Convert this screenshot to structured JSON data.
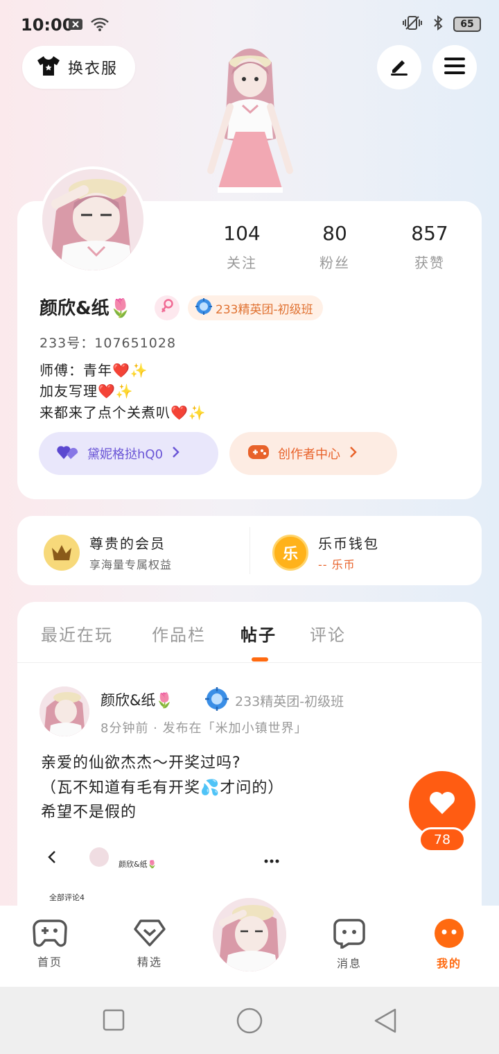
{
  "status_bar": {
    "time": "10:00",
    "battery": "65"
  },
  "top": {
    "outfit_label": "换衣服"
  },
  "profile": {
    "stats": [
      {
        "value": "104",
        "label": "关注"
      },
      {
        "value": "80",
        "label": "粉丝"
      },
      {
        "value": "857",
        "label": "获赞"
      }
    ],
    "username": "颜欣&纸🌷",
    "rank_badge": "233精英团-初级班",
    "uid": "233号：107651028",
    "bio": [
      "师傅：青年❤️✨",
      "加友写理❤️✨",
      "来都来了点个关煮叭❤️✨"
    ],
    "guild_label": "黛妮格挞hQ0",
    "creator_label": "创作者中心"
  },
  "member": {
    "vip_title": "尊贵的会员",
    "vip_sub": "享海量专属权益",
    "wallet_title": "乐币钱包",
    "wallet_sub": "-- 乐币",
    "coin_glyph": "乐"
  },
  "tabs": [
    "最近在玩",
    "作品栏",
    "帖子",
    "评论"
  ],
  "post": {
    "author": "颜欣&纸🌷",
    "rank": "233精英团-初级班",
    "meta": "8分钟前 · 发布在「米加小镇世界」",
    "lines": [
      "亲爱的仙欲杰杰～开奖过吗?",
      "（瓦不知道有毛有开奖💦才问的）",
      "希望不是假的"
    ],
    "image_author": "颜欣&纸🌷",
    "image_comments": "全部评论4"
  },
  "like_count": "78",
  "bottom_nav": [
    {
      "label": "首页"
    },
    {
      "label": "精选"
    },
    {
      "label": "消息"
    },
    {
      "label": "我的"
    }
  ],
  "colors": {
    "accent": "#ff6a10",
    "guild": "#6a55d6",
    "rank": "#e07232"
  }
}
